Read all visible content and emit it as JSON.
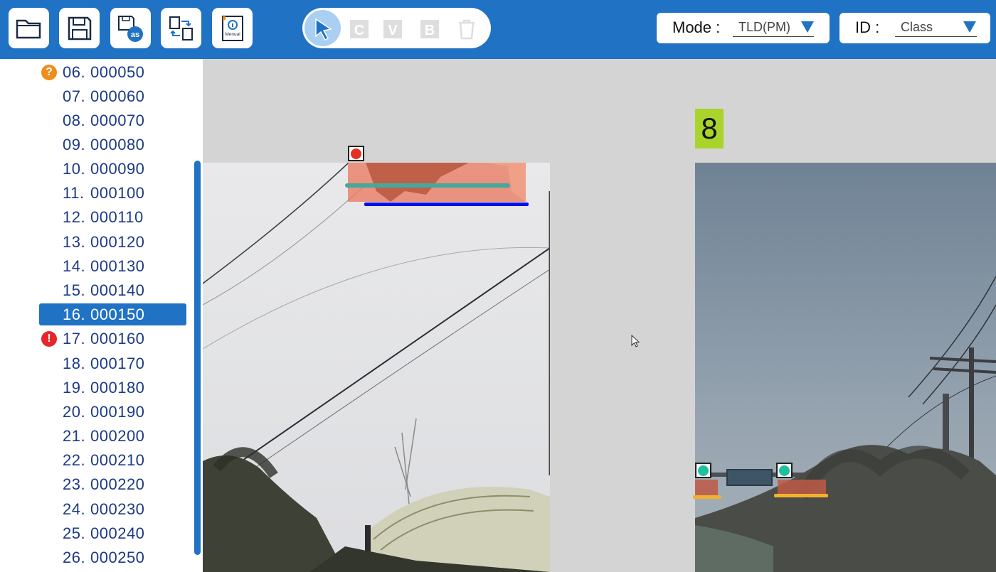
{
  "toolbar": {
    "buttons": [
      {
        "name": "open-folder",
        "icon": "folder-icon"
      },
      {
        "name": "save",
        "icon": "floppy-disk-icon"
      },
      {
        "name": "save-as",
        "icon": "save-as-icon",
        "label": "as"
      },
      {
        "name": "convert",
        "icon": "file-convert-icon"
      },
      {
        "name": "manual",
        "icon": "manual-book-icon",
        "label": "Menual"
      }
    ],
    "tools": [
      {
        "name": "pointer",
        "icon": "pointer-arrow-icon",
        "active": true
      },
      {
        "name": "c",
        "label": "C",
        "active": false
      },
      {
        "name": "v",
        "label": "V",
        "active": false
      },
      {
        "name": "b",
        "label": "B",
        "active": false
      },
      {
        "name": "delete",
        "icon": "trash-icon",
        "active": false
      }
    ],
    "mode": {
      "label": "Mode :",
      "value": "TLD(PM)"
    },
    "id": {
      "label": "ID :",
      "value": "Class"
    }
  },
  "file_list": {
    "items": [
      {
        "num": "06.",
        "name": "000050",
        "status": "warning",
        "badge": "?"
      },
      {
        "num": "07.",
        "name": "000060"
      },
      {
        "num": "08.",
        "name": "000070"
      },
      {
        "num": "09.",
        "name": "000080"
      },
      {
        "num": "10.",
        "name": "000090"
      },
      {
        "num": "11.",
        "name": "000100"
      },
      {
        "num": "12.",
        "name": "000110"
      },
      {
        "num": "13.",
        "name": "000120"
      },
      {
        "num": "14.",
        "name": "000130"
      },
      {
        "num": "15.",
        "name": "000140"
      },
      {
        "num": "16.",
        "name": "000150",
        "selected": true
      },
      {
        "num": "17.",
        "name": "000160",
        "status": "error",
        "badge": "!"
      },
      {
        "num": "18.",
        "name": "000170"
      },
      {
        "num": "19.",
        "name": "000180"
      },
      {
        "num": "20.",
        "name": "000190"
      },
      {
        "num": "21.",
        "name": "000200"
      },
      {
        "num": "22.",
        "name": "000210"
      },
      {
        "num": "23.",
        "name": "000220"
      },
      {
        "num": "24.",
        "name": "000230"
      },
      {
        "num": "25.",
        "name": "000240"
      },
      {
        "num": "26.",
        "name": "000250"
      }
    ]
  },
  "canvas": {
    "frame_number": "8"
  },
  "colors": {
    "brand": "#1f72c4",
    "selected": "#1f72c4",
    "warning": "#f08c19",
    "error": "#e5262a",
    "frame_badge": "#a9d42c",
    "red_light": "#e53222",
    "green_light": "#1fbfa0",
    "box_teal": "#44a89a",
    "box_blue": "#0a10e0",
    "box_orange": "#f2b230"
  }
}
